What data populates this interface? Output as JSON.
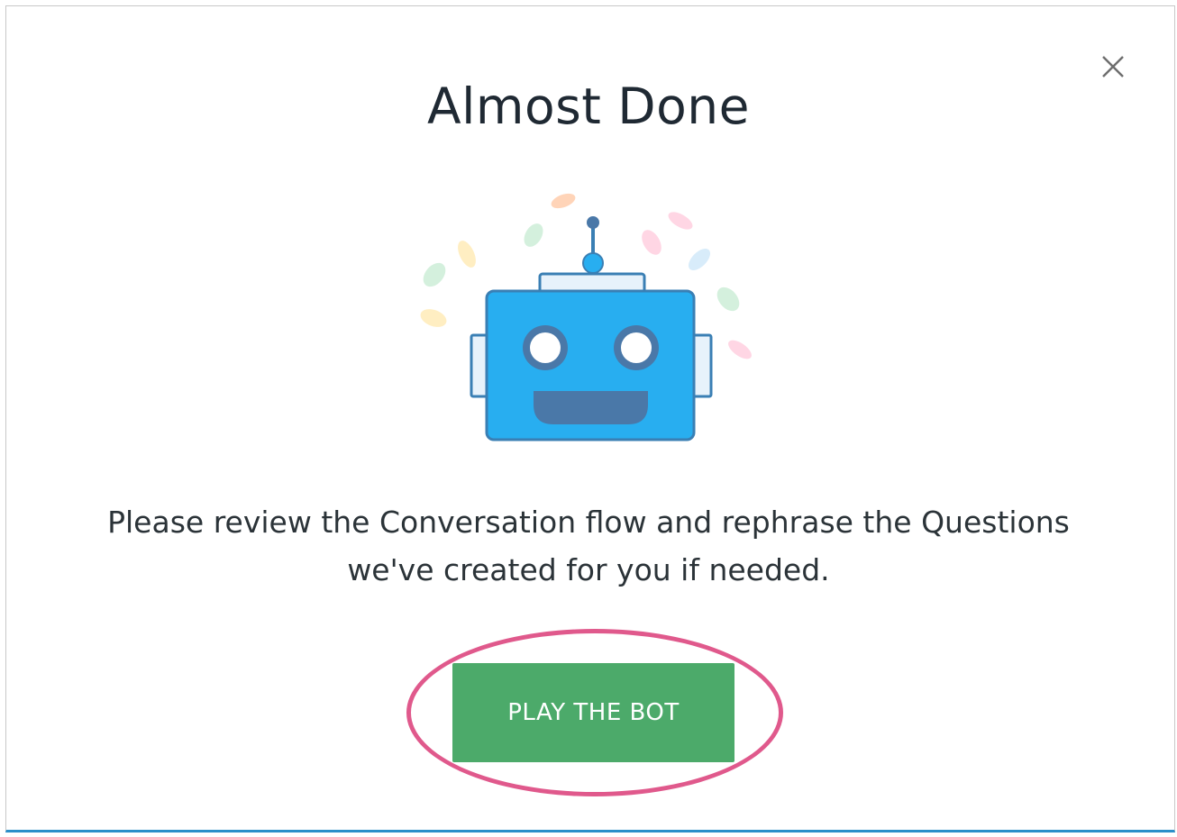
{
  "dialog": {
    "title": "Almost Done",
    "message_line1": "Please review the Conversation flow and rephrase the Questions",
    "message_line2": "we've created for you if needed.",
    "primary_button_label": "PLAY THE BOT",
    "close_icon": "close-icon",
    "illustration_icon": "robot-icon"
  },
  "colors": {
    "button": "#4caa6a",
    "highlight": "#e0598c",
    "robot_body": "#28aef0",
    "robot_outline": "#3a7fb4",
    "robot_mouth": "#4a78a8",
    "bottom_border": "#2c8fc9"
  }
}
